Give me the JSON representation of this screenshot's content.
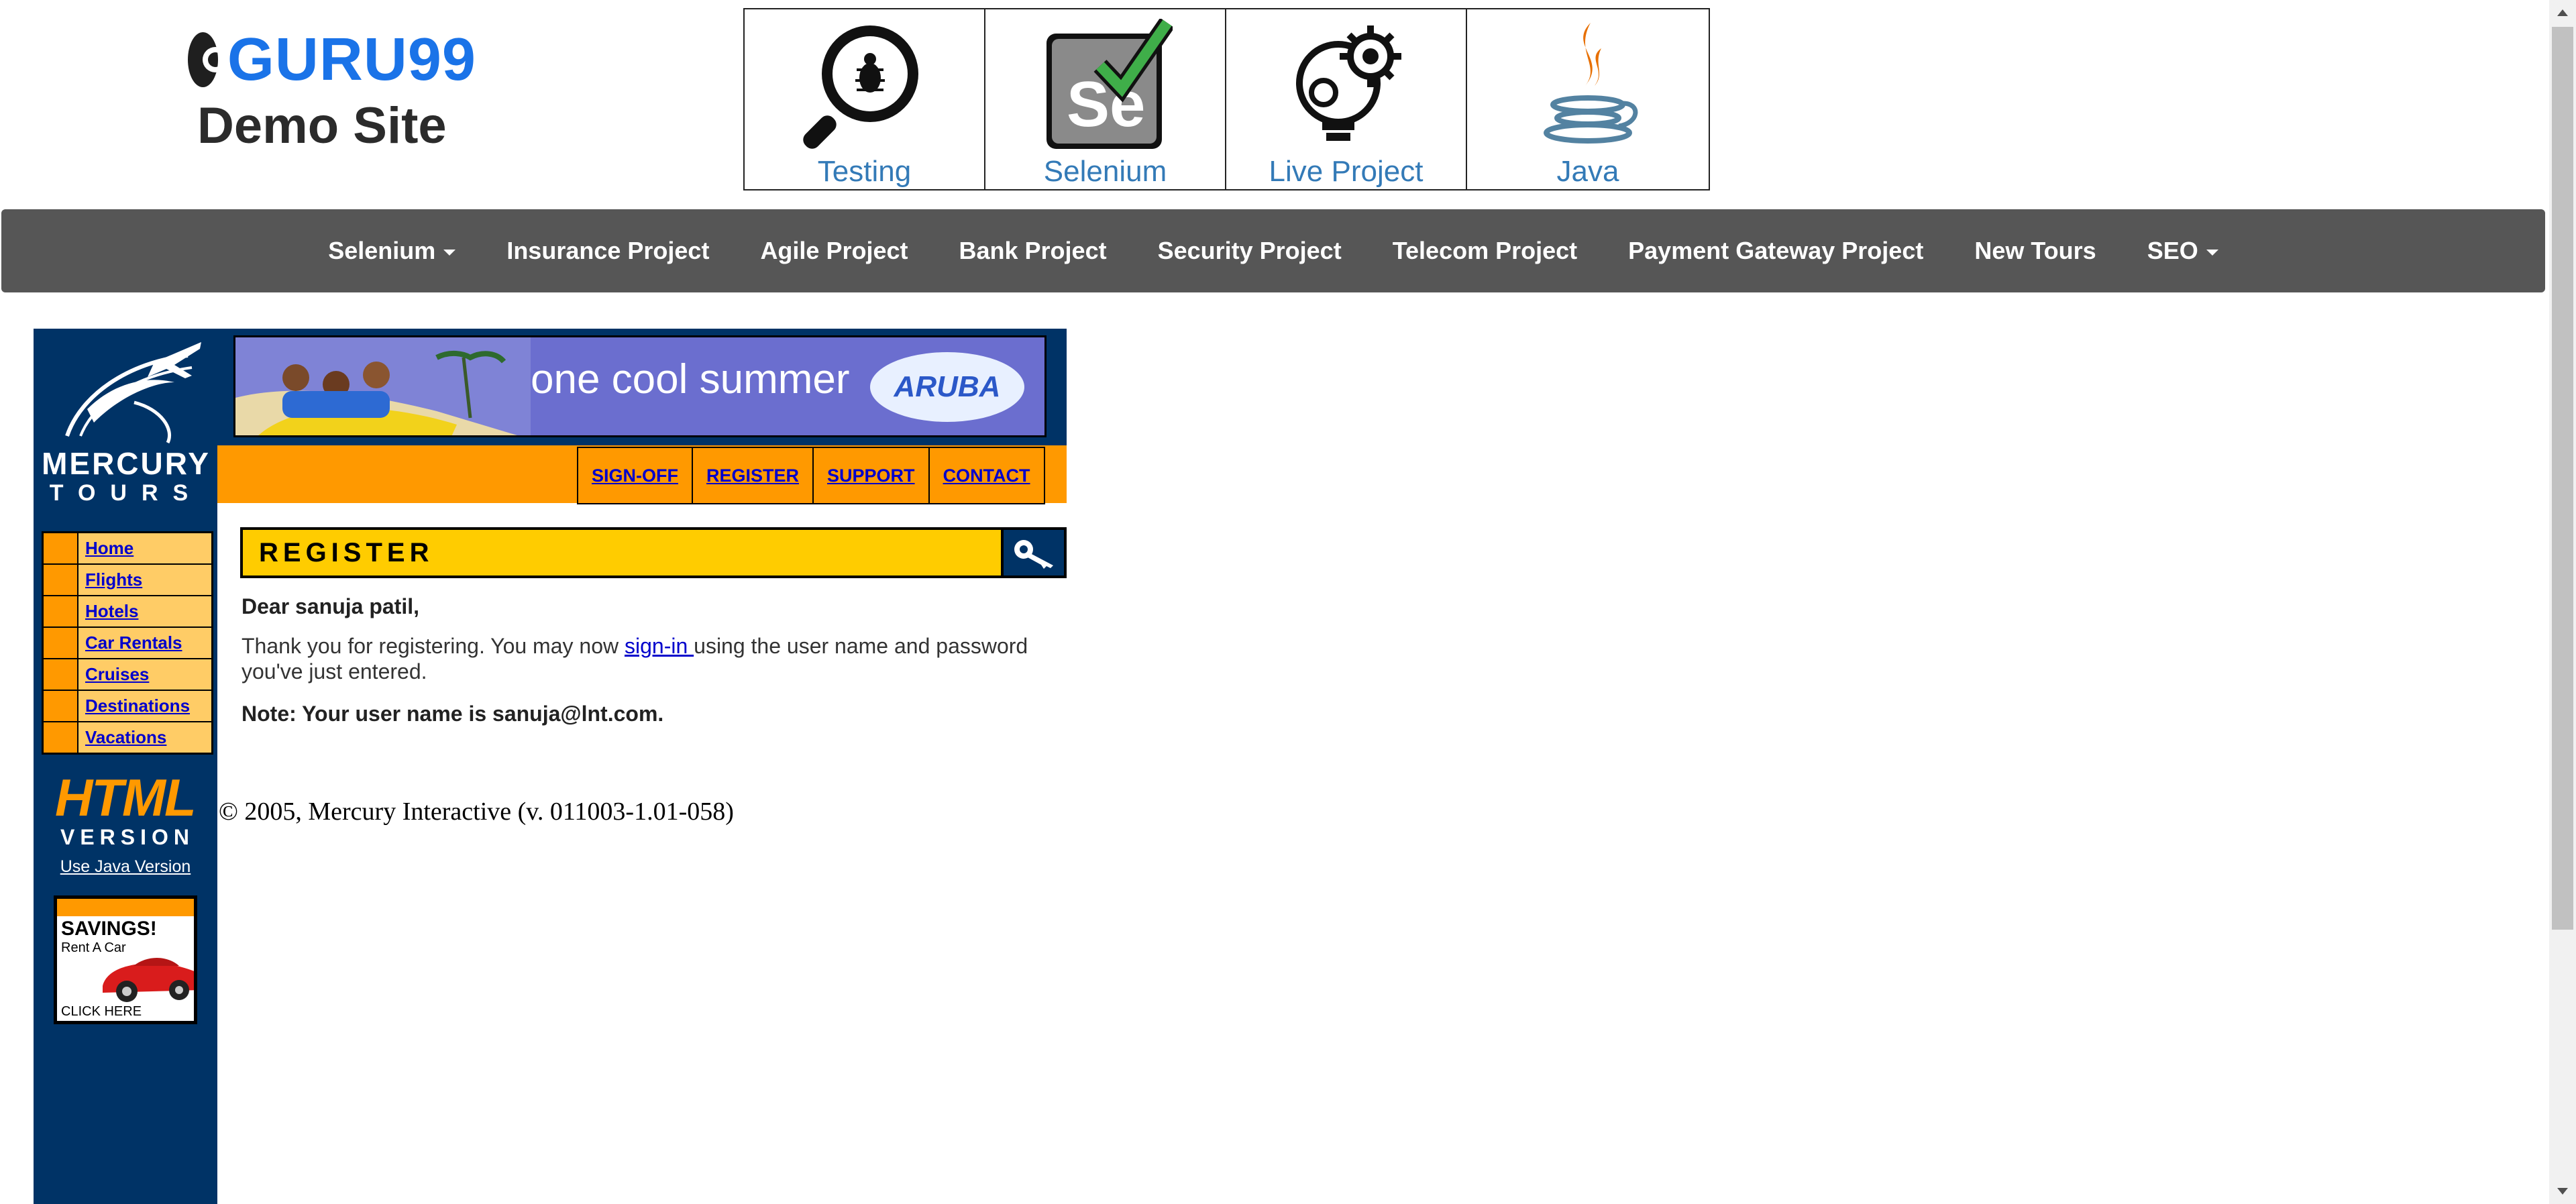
{
  "header": {
    "brand": "GURU99",
    "subtitle": "Demo Site",
    "tiles": [
      {
        "label": "Testing",
        "icon": "magnifier-bug-icon"
      },
      {
        "label": "Selenium",
        "icon": "selenium-check-icon"
      },
      {
        "label": "Live Project",
        "icon": "bulb-gear-icon"
      },
      {
        "label": "Java",
        "icon": "java-cup-icon"
      }
    ]
  },
  "navbar": {
    "items": [
      "Selenium",
      "Insurance Project",
      "Agile Project",
      "Bank Project",
      "Security Project",
      "Telecom Project",
      "Payment Gateway Project",
      "New Tours",
      "SEO"
    ]
  },
  "mercury": {
    "logo_title": "MERCURY",
    "logo_sub": "TOURS",
    "banner_text": "one cool summer",
    "banner_brand": "ARUBA",
    "top_links": [
      "SIGN-OFF",
      "REGISTER",
      "SUPPORT",
      "CONTACT"
    ],
    "side_menu": [
      "Home",
      "Flights",
      "Hotels",
      "Car Rentals",
      "Cruises",
      "Destinations",
      "Vacations"
    ],
    "html_badge": "HTML",
    "version_badge": "VERSION",
    "java_link": "Use Java Version",
    "ad": {
      "title": "SAVINGS!",
      "subtitle": "Rent A Car",
      "cta": "CLICK HERE"
    },
    "section_title": "REGISTER",
    "greeting": "Dear sanuja patil,",
    "thanks_before": "Thank you for registering. You may now ",
    "sign_in_link": "sign-in ",
    "thanks_after": "using the user name and password you've just entered.",
    "note": "Note: Your user name is sanuja@lnt.com.",
    "copyright": "© 2005, Mercury Interactive (v. 011003-1.01-058)"
  },
  "colors": {
    "brand_blue": "#1a73e8",
    "navbar_bg": "#565656",
    "mercury_navy": "#003366",
    "mercury_orange": "#ff9900",
    "mercury_yellow": "#ffcc00",
    "link_blue": "#0000cc"
  }
}
